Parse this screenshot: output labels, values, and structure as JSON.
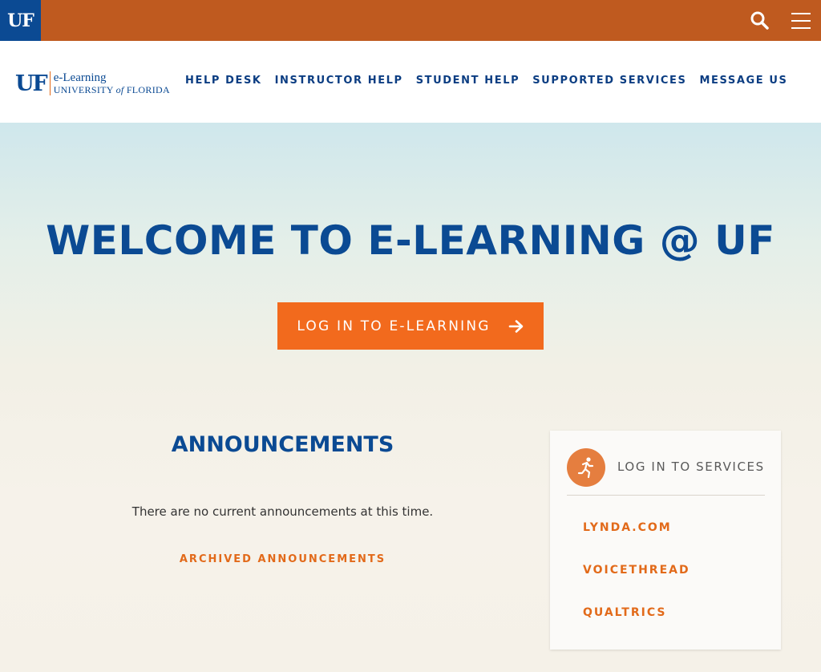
{
  "topbar": {
    "logo_text": "UF",
    "search_icon": "search-icon",
    "menu_icon": "hamburger-menu-icon",
    "bar_color": "#bf5a1f",
    "logo_bg": "#0b4a93"
  },
  "brand": {
    "mark": "UF",
    "line1": "e-Learning",
    "line2_prefix": "UNIVERSITY ",
    "line2_of": "of",
    "line2_suffix": " FLORIDA"
  },
  "nav": {
    "items": [
      {
        "label": "HELP DESK"
      },
      {
        "label": "INSTRUCTOR HELP"
      },
      {
        "label": "STUDENT HELP"
      },
      {
        "label": "SUPPORTED SERVICES"
      },
      {
        "label": "MESSAGE US"
      }
    ]
  },
  "hero": {
    "title": "WELCOME TO E-LEARNING @ UF",
    "login_button": "LOG IN TO E-LEARNING",
    "login_icon": "arrow-right-icon",
    "accent": "#f26a1d"
  },
  "announcements": {
    "title": "ANNOUNCEMENTS",
    "empty_text": "There are no current announcements at this time.",
    "archive_link": "ARCHIVED ANNOUNCEMENTS"
  },
  "services": {
    "icon": "running-person-icon",
    "title": "LOG IN TO SERVICES",
    "links": [
      {
        "label": "LYNDA.COM"
      },
      {
        "label": "VOICETHREAD"
      },
      {
        "label": "QUALTRICS"
      }
    ]
  }
}
